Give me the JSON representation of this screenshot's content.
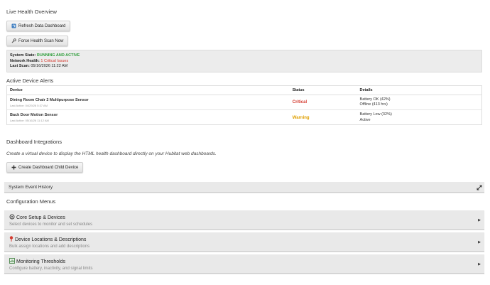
{
  "page": {
    "title": "Live Health Overview",
    "refresh_button": "Refresh Data Dashboard",
    "force_scan_button": "Force Health Scan Now"
  },
  "system": {
    "state_label": "System State:",
    "state_value": "RUNNING AND ACTIVE",
    "health_label": "Network Health:",
    "health_value": "1 Critical Issues",
    "scan_label": "Last Scan:",
    "scan_value": "05/16/2026 11:22 AM"
  },
  "alerts": {
    "title": "Active Device Alerts",
    "columns": [
      "Device",
      "Status",
      "Details"
    ],
    "rows": [
      {
        "device": "Dining Room Chair 2 Multipurpose Sensor",
        "last_active": "Last Active: 04/29/26 5:37 AM",
        "status": "Critical",
        "detail1": "Battery OK (42%)",
        "detail2": "Offline (413 hrs)"
      },
      {
        "device": "Back Door Motion Sensor",
        "last_active": "Last Active: 05/16/26 11:12 AM",
        "status": "Warning",
        "detail1": "Battery Low (32%)",
        "detail2": "Active"
      }
    ]
  },
  "integrations": {
    "title": "Dashboard Integrations",
    "description": "Create a virtual device to display the HTML health dashboard directly on your Hubitat web dashboards.",
    "create_button": "Create Dashboard Child Device"
  },
  "history": {
    "label": "System Event History"
  },
  "config": {
    "title": "Configuration Menus",
    "menus": [
      {
        "title": "Core Setup & Devices",
        "subtitle": "Select devices to monitor and set schedules",
        "icon": "gear-icon"
      },
      {
        "title": "Device Locations & Descriptions",
        "subtitle": "Bulk assign locations and add descriptions",
        "icon": "map-pin-icon"
      },
      {
        "title": "Monitoring Thresholds",
        "subtitle": "Configure battery, inactivity, and signal limits",
        "icon": "chart-icon"
      }
    ]
  },
  "colors": {
    "accent_green": "#2e9d3a",
    "accent_red": "#d43a2f",
    "warning_yellow": "#e0a000"
  }
}
